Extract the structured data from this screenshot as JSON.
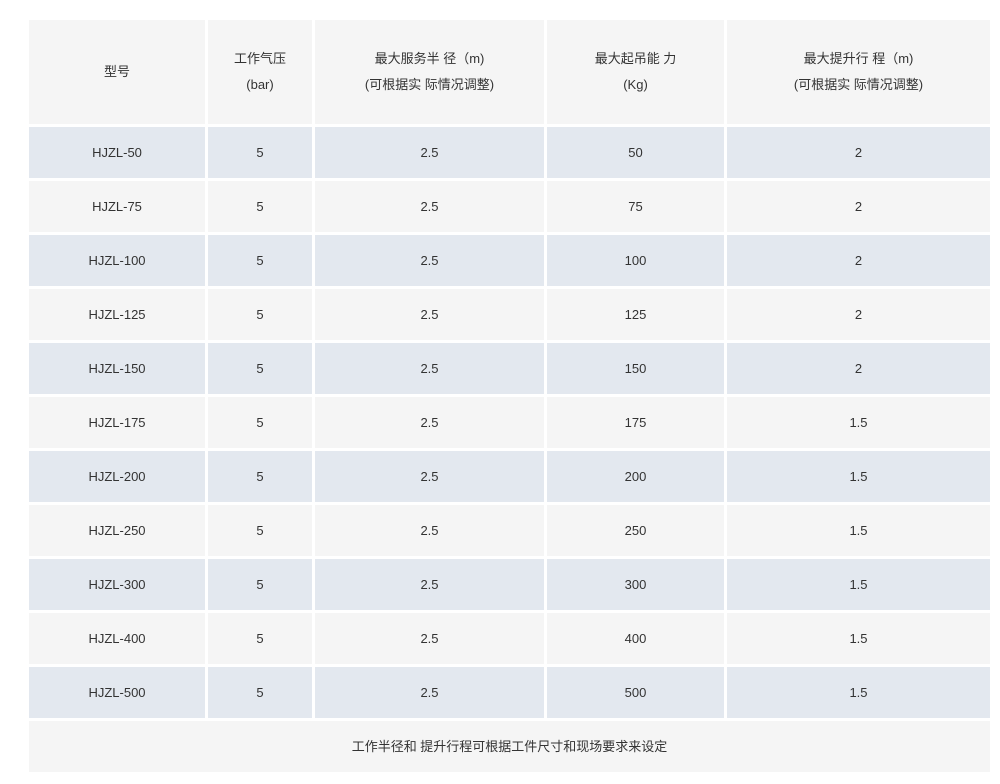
{
  "header": {
    "model": {
      "line1": "型号",
      "line2": ""
    },
    "pressure": {
      "line1": "工作气压",
      "line2": "(bar)"
    },
    "radius": {
      "line1": "最大服务半 径（m)",
      "line2": "(可根据实 际情况调整)"
    },
    "capacity": {
      "line1": "最大起吊能 力",
      "line2": "(Kg)"
    },
    "lift": {
      "line1": "最大提升行 程（m)",
      "line2": "(可根据实 际情况调整)"
    }
  },
  "rows": [
    {
      "model": "HJZL-50",
      "pressure": "5",
      "radius": "2.5",
      "capacity": "50",
      "lift": "2"
    },
    {
      "model": "HJZL-75",
      "pressure": "5",
      "radius": "2.5",
      "capacity": "75",
      "lift": "2"
    },
    {
      "model": "HJZL-100",
      "pressure": "5",
      "radius": "2.5",
      "capacity": "100",
      "lift": "2"
    },
    {
      "model": "HJZL-125",
      "pressure": "5",
      "radius": "2.5",
      "capacity": "125",
      "lift": "2"
    },
    {
      "model": "HJZL-150",
      "pressure": "5",
      "radius": "2.5",
      "capacity": "150",
      "lift": "2"
    },
    {
      "model": "HJZL-175",
      "pressure": "5",
      "radius": "2.5",
      "capacity": "175",
      "lift": "1.5"
    },
    {
      "model": "HJZL-200",
      "pressure": "5",
      "radius": "2.5",
      "capacity": "200",
      "lift": "1.5"
    },
    {
      "model": "HJZL-250",
      "pressure": "5",
      "radius": "2.5",
      "capacity": "250",
      "lift": "1.5"
    },
    {
      "model": "HJZL-300",
      "pressure": "5",
      "radius": "2.5",
      "capacity": "300",
      "lift": "1.5"
    },
    {
      "model": "HJZL-400",
      "pressure": "5",
      "radius": "2.5",
      "capacity": "400",
      "lift": "1.5"
    },
    {
      "model": "HJZL-500",
      "pressure": "5",
      "radius": "2.5",
      "capacity": "500",
      "lift": "1.5"
    }
  ],
  "footer": {
    "note": "工作半径和 提升行程可根据工件尺寸和现场要求来设定"
  },
  "colors": {
    "shaded_row": "#e3e8ef",
    "plain_row": "#f5f5f5",
    "text": "#333333"
  }
}
